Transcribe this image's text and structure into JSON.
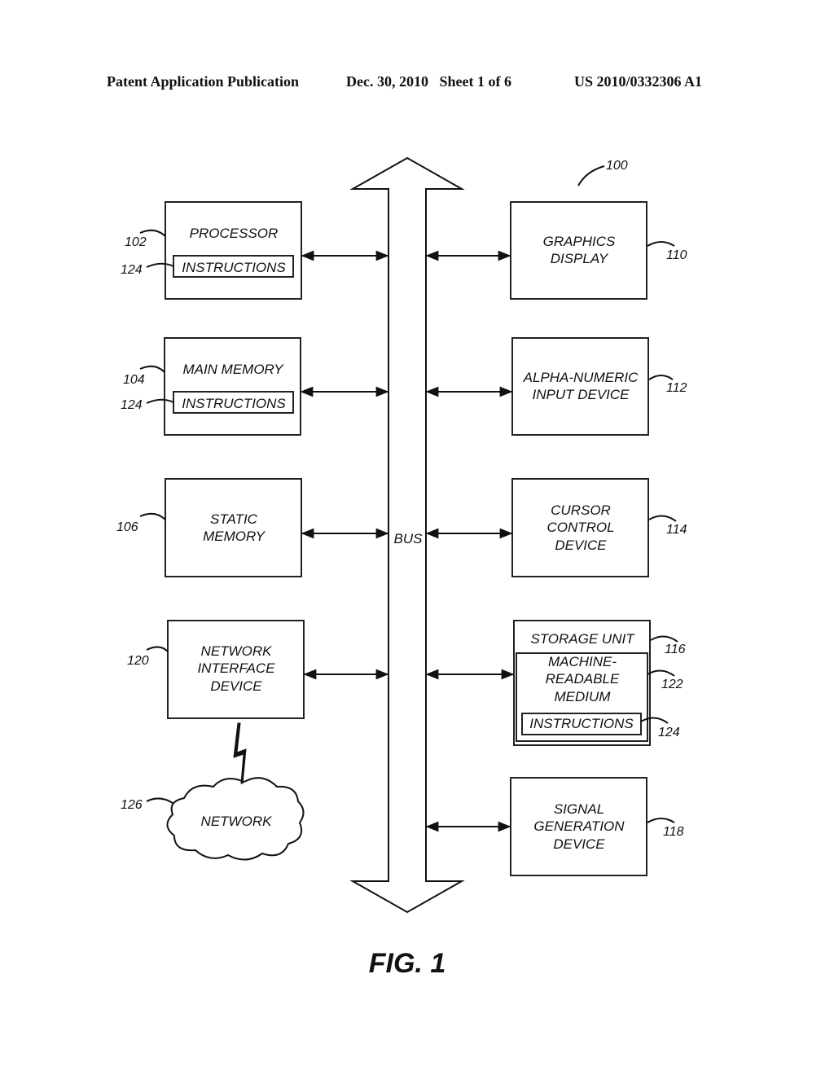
{
  "header": {
    "publication_type": "Patent Application Publication",
    "date_sheet": "Dec. 30, 2010   Sheet 1 of 6",
    "publication_number": "US 2010/0332306 A1"
  },
  "figure": {
    "label": "FIG. 1",
    "system_ref": "100",
    "bus": {
      "label": "BUS"
    },
    "blocks": {
      "processor": {
        "ref": "102",
        "lines": [
          "PROCESSOR"
        ],
        "inner": {
          "ref": "124",
          "label": "INSTRUCTIONS"
        }
      },
      "main_memory": {
        "ref": "104",
        "lines": [
          "MAIN MEMORY"
        ],
        "inner": {
          "ref": "124",
          "label": "INSTRUCTIONS"
        }
      },
      "static_memory": {
        "ref": "106",
        "lines": [
          "STATIC",
          "MEMORY"
        ]
      },
      "network_interface": {
        "ref": "120",
        "lines": [
          "NETWORK",
          "INTERFACE",
          "DEVICE"
        ]
      },
      "network": {
        "ref": "126",
        "label": "NETWORK"
      },
      "graphics_display": {
        "ref": "110",
        "lines": [
          "GRAPHICS",
          "DISPLAY"
        ]
      },
      "alpha_numeric": {
        "ref": "112",
        "lines": [
          "ALPHA-NUMERIC",
          "INPUT DEVICE"
        ]
      },
      "cursor_control": {
        "ref": "114",
        "lines": [
          "CURSOR",
          "CONTROL",
          "DEVICE"
        ]
      },
      "storage_unit": {
        "ref": "116",
        "label": "STORAGE UNIT",
        "medium": {
          "ref": "122",
          "lines": [
            "MACHINE-",
            "READABLE",
            "MEDIUM"
          ]
        },
        "inner": {
          "ref": "124",
          "label": "INSTRUCTIONS"
        }
      },
      "signal_generation": {
        "ref": "118",
        "lines": [
          "SIGNAL",
          "GENERATION",
          "DEVICE"
        ]
      }
    }
  }
}
